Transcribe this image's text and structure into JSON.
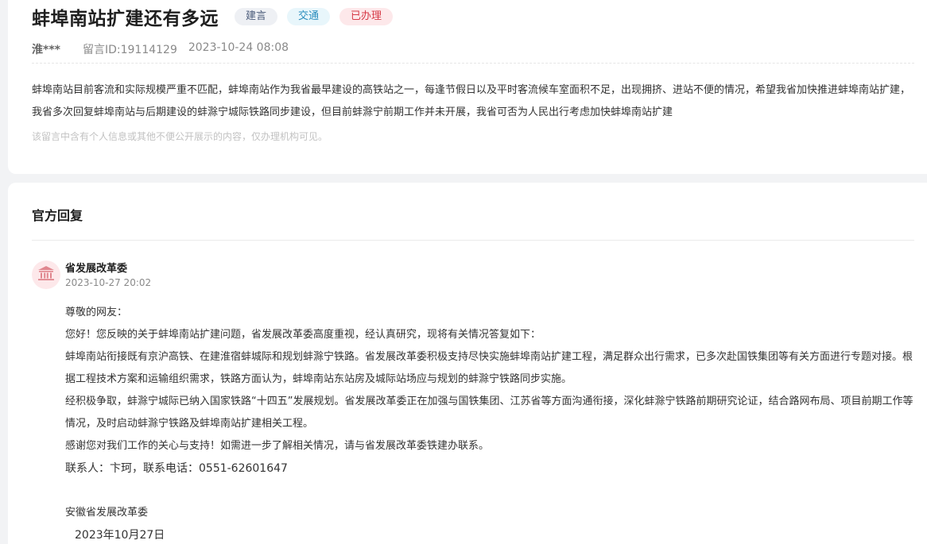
{
  "message": {
    "title": "蚌埠南站扩建还有多远",
    "tags": [
      "建言",
      "交通",
      "已办理"
    ],
    "user": "淮***",
    "message_id": "留言ID:19114129",
    "datetime": "2023-10-24 08:08",
    "content": "蚌埠南站目前客流和实际规模严重不匹配，蚌埠南站作为我省最早建设的高铁站之一，每逢节假日以及平时客流候车室面积不足，出现拥挤、进站不便的情况，希望我省加快推进蚌埠南站扩建，我省多次回复蚌埠南站与后期建设的蚌滁宁城际铁路同步建设，但目前蚌滁宁前期工作并未开展，我省可否为人民出行考虑加快蚌埠南站扩建",
    "privacy_note": "该留言中含有个人信息或其他不便公开展示的内容，仅办理机构可见。"
  },
  "reply": {
    "section_title": "官方回复",
    "avatar_icon": "government-building-icon",
    "org": "省发展改革委",
    "date": "2023-10-27 20:02",
    "greeting": "尊敬的网友：",
    "paragraphs": [
      "您好！您反映的关于蚌埠南站扩建问题，省发展改革委高度重视，经认真研究，现将有关情况答复如下：",
      "蚌埠南站衔接既有京沪高铁、在建淮宿蚌城际和规划蚌滁宁铁路。省发展改革委积极支持尽快实施蚌埠南站扩建工程，满足群众出行需求，已多次赴国铁集团等有关方面进行专题对接。根据工程技术方案和运输组织需求，铁路方面认为，蚌埠南站东站房及城际站场应与规划的蚌滁宁铁路同步实施。",
      "经积极争取，蚌滁宁城际已纳入国家铁路“十四五”发展规划。省发展改革委正在加强与国铁集团、江苏省等方面沟通衔接，深化蚌滁宁铁路前期研究论证，结合路网布局、项目前期工作等情况，及时启动蚌滁宁铁路及蚌埠南站扩建相关工程。",
      "感谢您对我们工作的关心与支持！如需进一步了解相关情况，请与省发展改革委铁建办联系。"
    ],
    "contact": "联系人：卞珂，联系电话：0551-62601647",
    "signature": "安徽省发展改革委",
    "sign_date": "2023年10月27日"
  },
  "colors": {
    "tag_gray_bg": "#eef0f4",
    "tag_blue_bg": "#e8f6fb",
    "tag_red_bg": "#fde8ea",
    "tag_red_text": "#d63a47"
  }
}
